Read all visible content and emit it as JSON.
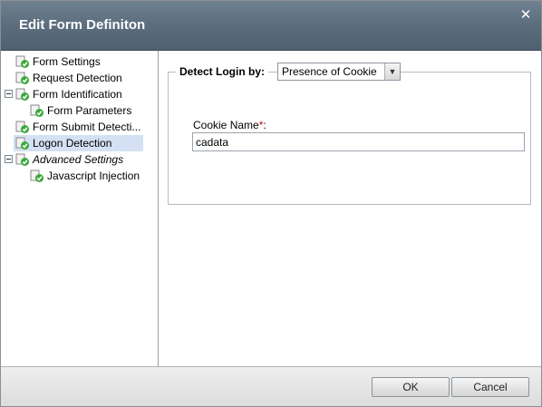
{
  "dialog": {
    "title": "Edit Form Definiton",
    "close_icon": "close-icon"
  },
  "tree": {
    "items": [
      {
        "label": "Form Settings",
        "icon": "check-icon",
        "level": 1,
        "italic": false,
        "selected": false
      },
      {
        "label": "Request Detection",
        "icon": "check-icon",
        "level": 1,
        "italic": false,
        "selected": false
      },
      {
        "label": "Form Identification",
        "icon": "check-icon",
        "level": 1,
        "italic": false,
        "selected": false,
        "expanded": true
      },
      {
        "label": "Form Parameters",
        "icon": "check-icon",
        "level": 2,
        "italic": false,
        "selected": false
      },
      {
        "label": "Form Submit Detecti...",
        "icon": "check-icon",
        "level": 1,
        "italic": false,
        "selected": false
      },
      {
        "label": "Logon Detection",
        "icon": "check-icon",
        "level": 1,
        "italic": false,
        "selected": true
      },
      {
        "label": "Advanced Settings",
        "icon": "check-icon",
        "level": 1,
        "italic": true,
        "selected": false,
        "expanded": true
      },
      {
        "label": "Javascript Injection",
        "icon": "check-icon",
        "level": 2,
        "italic": false,
        "selected": false
      }
    ]
  },
  "form": {
    "legend": "Detect Login by:",
    "detect_select_value": "Presence of Cookie",
    "cookie_label": "Cookie Name",
    "required_mark": "*",
    "label_suffix": ":",
    "cookie_value": "cadata"
  },
  "footer": {
    "ok_label": "OK",
    "cancel_label": "Cancel"
  },
  "colors": {
    "titlebar": "#5c6d7e",
    "selected_row": "#d4e1f4",
    "required": "#cc0000"
  }
}
